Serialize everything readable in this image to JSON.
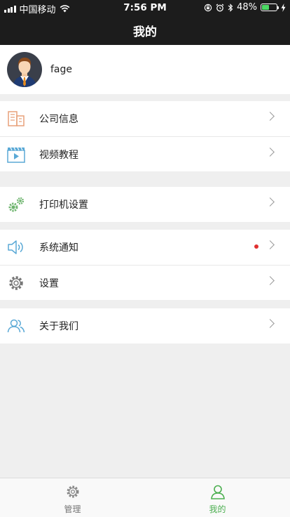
{
  "status_bar": {
    "carrier": "中国移动",
    "time": "7:56 PM",
    "battery_percent": "48%",
    "battery_level": 0.48,
    "icons": [
      "signal-icon",
      "wifi-icon",
      "orientation-lock-icon",
      "alarm-icon",
      "bluetooth-icon",
      "battery-icon",
      "charging-icon"
    ]
  },
  "header": {
    "title": "我的"
  },
  "profile": {
    "name": "fage"
  },
  "menu": {
    "company_info": {
      "label": "公司信息",
      "icon": "building-icon"
    },
    "video_tutorial": {
      "label": "视频教程",
      "icon": "video-icon"
    },
    "printer_settings": {
      "label": "打印机设置",
      "icon": "gears-icon"
    },
    "system_notice": {
      "label": "系统通知",
      "icon": "speaker-icon",
      "has_unread": true
    },
    "settings": {
      "label": "设置",
      "icon": "gear-icon"
    },
    "about_us": {
      "label": "关于我们",
      "icon": "people-icon"
    }
  },
  "tabbar": {
    "items": [
      {
        "label": "管理",
        "icon": "gear-icon",
        "active": false
      },
      {
        "label": "我的",
        "icon": "person-icon",
        "active": true
      }
    ]
  },
  "colors": {
    "header_bg": "#1c1c1c",
    "accent_green": "#4caf50",
    "unread_dot": "#e03030",
    "page_bg": "#efefef"
  }
}
